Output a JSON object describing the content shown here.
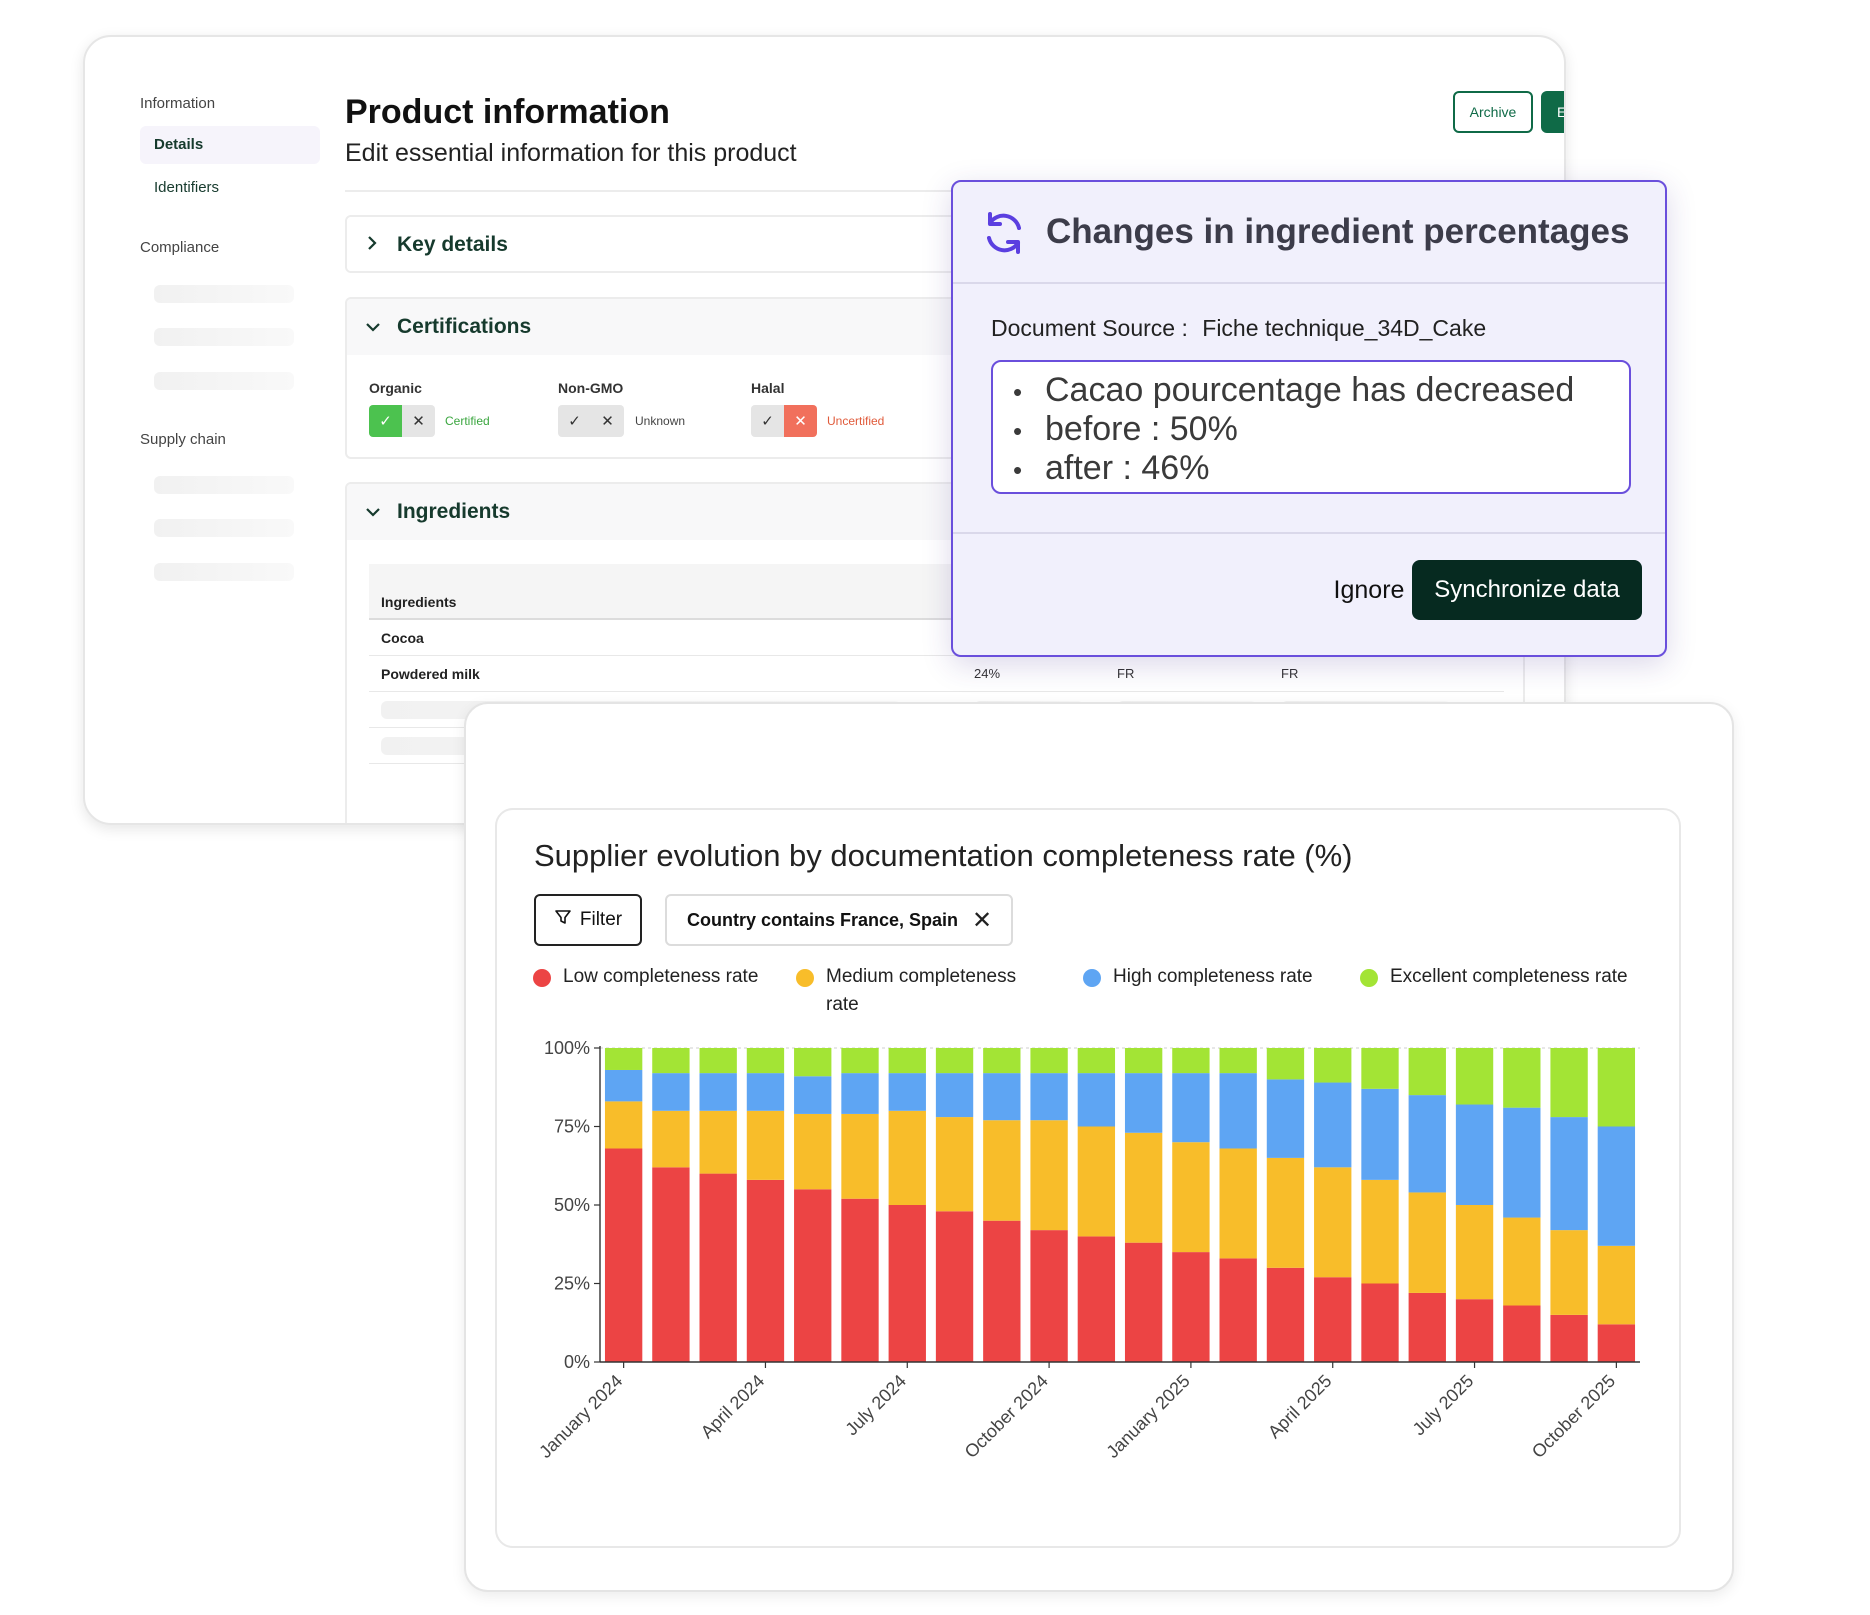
{
  "sidebar": {
    "sections": [
      "Information",
      "Compliance",
      "Supply chain"
    ],
    "items": [
      {
        "label": "Details",
        "active": true
      },
      {
        "label": "Identifiers",
        "active": false
      }
    ]
  },
  "header": {
    "title": "Product information",
    "subtitle": "Edit essential information for this product",
    "archive_label": "Archive",
    "edit_label": "Edit"
  },
  "sections": {
    "key_details": "Key details",
    "certifications": "Certifications",
    "ingredients": "Ingredients"
  },
  "certifications": [
    {
      "name": "Organic",
      "status": "Certified",
      "selected": "check",
      "status_color": "#3aa63f"
    },
    {
      "name": "Non-GMO",
      "status": "Unknown",
      "selected": "none",
      "status_color": "#444444"
    },
    {
      "name": "Halal",
      "status": "Uncertified",
      "selected": "cross",
      "status_color": "#e05a3a"
    }
  ],
  "ingredients_table": {
    "header": "Ingredients",
    "rows": [
      {
        "name": "Cocoa",
        "percent": "",
        "c1": "",
        "c2": ""
      },
      {
        "name": "Powdered milk",
        "percent": "24%",
        "c1": "FR",
        "c2": "FR"
      }
    ]
  },
  "popup": {
    "title": "Changes in ingredient percentages",
    "doc_source_label": "Document Source :",
    "doc_source_value": "Fiche technique_34D_Cake",
    "changes": [
      "Cacao pourcentage has decreased",
      "before : 50%",
      "after : 46%"
    ],
    "ignore_label": "Ignore",
    "sync_label": "Synchronize data",
    "accent": "#6a4fdc"
  },
  "chart_header": {
    "title": "Supplier evolution by documentation completeness rate (%)",
    "filter_label": "Filter",
    "chip_label": "Country contains France, Spain"
  },
  "chart_data": {
    "type": "bar",
    "stacked": true,
    "title": "Supplier evolution by documentation completeness rate (%)",
    "xlabel": "",
    "ylabel": "",
    "ylim": [
      0,
      100
    ],
    "y_ticks": [
      "0%",
      "25%",
      "50%",
      "75%",
      "100%"
    ],
    "x_tick_labels": [
      "January 2024",
      "April 2024",
      "July 2024",
      "October 2024",
      "January 2025",
      "April 2025",
      "July 2025",
      "October 2025"
    ],
    "categories": [
      "2024-01",
      "2024-02",
      "2024-03",
      "2024-04",
      "2024-05",
      "2024-06",
      "2024-07",
      "2024-08",
      "2024-09",
      "2024-10",
      "2024-11",
      "2024-12",
      "2025-01",
      "2025-02",
      "2025-03",
      "2025-04",
      "2025-05",
      "2025-06",
      "2025-07",
      "2025-08",
      "2025-09",
      "2025-10"
    ],
    "legend_position": "top",
    "series": [
      {
        "name": "Low completeness rate",
        "color": "#ec4444",
        "values": [
          68,
          62,
          60,
          58,
          55,
          52,
          50,
          48,
          45,
          42,
          40,
          38,
          35,
          33,
          30,
          27,
          25,
          22,
          20,
          18,
          15,
          12
        ]
      },
      {
        "name": "Medium completeness rate",
        "color": "#f8bd2a",
        "values": [
          15,
          18,
          20,
          22,
          24,
          27,
          30,
          30,
          32,
          35,
          35,
          35,
          35,
          35,
          35,
          35,
          33,
          32,
          30,
          28,
          27,
          25
        ]
      },
      {
        "name": "High completeness rate",
        "color": "#5ea5f3",
        "values": [
          10,
          12,
          12,
          12,
          12,
          13,
          12,
          14,
          15,
          15,
          17,
          19,
          22,
          24,
          25,
          27,
          29,
          31,
          32,
          35,
          36,
          38
        ]
      },
      {
        "name": "Excellent completeness rate",
        "color": "#a3e435",
        "values": [
          7,
          8,
          8,
          8,
          9,
          8,
          8,
          8,
          8,
          8,
          8,
          8,
          8,
          8,
          10,
          11,
          13,
          15,
          18,
          19,
          22,
          25
        ]
      }
    ]
  }
}
